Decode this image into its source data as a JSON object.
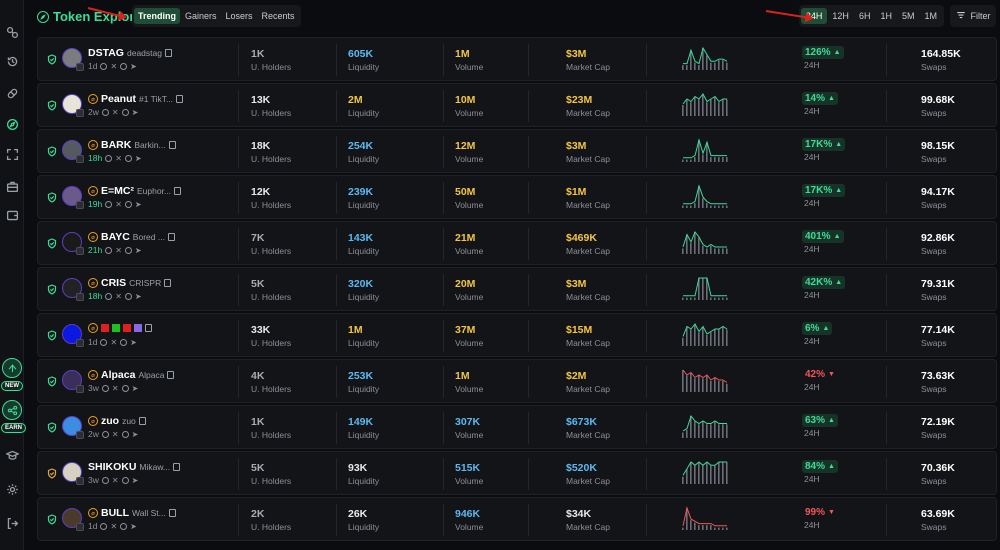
{
  "app": {
    "title": "Token Explorer",
    "accent": "#3ddc97"
  },
  "rail": {
    "badges": [
      {
        "label": "NEW"
      },
      {
        "label": "EARN"
      }
    ]
  },
  "tabs": [
    {
      "label": "Trending",
      "active": true
    },
    {
      "label": "Gainers",
      "active": false
    },
    {
      "label": "Losers",
      "active": false
    },
    {
      "label": "Recents",
      "active": false
    }
  ],
  "timeframes": [
    {
      "label": "24H",
      "active": true
    },
    {
      "label": "12H",
      "active": false
    },
    {
      "label": "6H",
      "active": false
    },
    {
      "label": "1H",
      "active": false
    },
    {
      "label": "5M",
      "active": false
    },
    {
      "label": "1M",
      "active": false
    }
  ],
  "filter_label": "Filter",
  "labels": {
    "holders": "U. Holders",
    "liquidity": "Liquidity",
    "volume": "Volume",
    "mcap": "Market Cap",
    "period": "24H",
    "swaps": "Swaps"
  },
  "tokens": [
    {
      "symbol": "DSTAG",
      "name": "deadstag",
      "age": "1d",
      "age_green": false,
      "pump": false,
      "holders": "1K",
      "liquidity": "605K",
      "volume": "1M",
      "mcap": "$3M",
      "change": "126%",
      "dir": "up",
      "swaps": "164.85K",
      "avatar": "#7a7c80",
      "liq_color": "blue",
      "vol_color": "yellow",
      "mcap_color": "yellow",
      "hold_color": "grey",
      "spark": [
        2,
        2,
        8,
        3,
        2,
        9,
        6,
        3,
        3,
        4,
        4,
        3
      ],
      "spark_color": "#3ddc97"
    },
    {
      "symbol": "Peanut",
      "name": "#1 TikT...",
      "age": "2w",
      "age_green": false,
      "pump": true,
      "holders": "13K",
      "liquidity": "2M",
      "volume": "10M",
      "mcap": "$23M",
      "change": "14%",
      "dir": "up",
      "swaps": "99.68K",
      "avatar": "#e8e4d8",
      "liq_color": "yellow",
      "vol_color": "yellow",
      "mcap_color": "yellow",
      "hold_color": "white",
      "spark": [
        4,
        6,
        5,
        7,
        6,
        8,
        5,
        6,
        7,
        5,
        6,
        6
      ],
      "spark_color": "#3ddc97"
    },
    {
      "symbol": "BARK",
      "name": "Barkin...",
      "age": "18h",
      "age_green": true,
      "pump": true,
      "holders": "18K",
      "liquidity": "254K",
      "volume": "12M",
      "mcap": "$3M",
      "change": "17K%",
      "dir": "up",
      "swaps": "98.15K",
      "avatar": "#555a60",
      "liq_color": "blue",
      "vol_color": "yellow",
      "mcap_color": "yellow",
      "hold_color": "white",
      "spark": [
        1,
        1,
        1,
        2,
        9,
        3,
        8,
        2,
        2,
        2,
        2,
        2
      ],
      "spark_color": "#3ddc97"
    },
    {
      "symbol": "E=MC²",
      "name": "Euphor...",
      "age": "19h",
      "age_green": true,
      "pump": true,
      "holders": "12K",
      "liquidity": "239K",
      "volume": "50M",
      "mcap": "$1M",
      "change": "17K%",
      "dir": "up",
      "swaps": "94.17K",
      "avatar": "#6a5a8a",
      "liq_color": "blue",
      "vol_color": "yellow",
      "mcap_color": "yellow",
      "hold_color": "white",
      "spark": [
        1,
        1,
        1,
        2,
        9,
        4,
        2,
        1,
        1,
        1,
        1,
        1
      ],
      "spark_color": "#3ddc97"
    },
    {
      "symbol": "BAYC",
      "name": "Bored ...",
      "age": "21h",
      "age_green": true,
      "pump": true,
      "holders": "7K",
      "liquidity": "143K",
      "volume": "21M",
      "mcap": "$469K",
      "change": "401%",
      "dir": "up",
      "swaps": "92.86K",
      "avatar": "#1a1a1a",
      "liq_color": "blue",
      "vol_color": "yellow",
      "mcap_color": "yellow",
      "hold_color": "grey",
      "spark": [
        2,
        7,
        4,
        8,
        6,
        3,
        2,
        3,
        2,
        2,
        2,
        2
      ],
      "spark_color": "#3ddc97"
    },
    {
      "symbol": "CRIS",
      "name": "CRISPR",
      "age": "18h",
      "age_green": true,
      "pump": true,
      "holders": "5K",
      "liquidity": "320K",
      "volume": "20M",
      "mcap": "$3M",
      "change": "42K%",
      "dir": "up",
      "swaps": "79.31K",
      "avatar": "#222226",
      "liq_color": "blue",
      "vol_color": "yellow",
      "mcap_color": "yellow",
      "hold_color": "grey",
      "spark": [
        1,
        1,
        1,
        1,
        9,
        9,
        9,
        1,
        1,
        1,
        1,
        1
      ],
      "spark_color": "#3ddc97"
    },
    {
      "symbol": "",
      "name": "",
      "age": "1d",
      "age_green": false,
      "pump": true,
      "holders": "33K",
      "liquidity": "1M",
      "volume": "37M",
      "mcap": "$15M",
      "change": "6%",
      "dir": "up",
      "swaps": "77.14K",
      "avatar": "#0a18e0",
      "liq_color": "yellow",
      "vol_color": "yellow",
      "mcap_color": "yellow",
      "hold_color": "white",
      "spark": [
        3,
        7,
        6,
        8,
        5,
        7,
        4,
        5,
        6,
        6,
        7,
        6
      ],
      "spark_color": "#3ddc97"
    },
    {
      "symbol": "Alpaca",
      "name": "Alpaca",
      "age": "3w",
      "age_green": false,
      "pump": true,
      "holders": "4K",
      "liquidity": "253K",
      "volume": "1M",
      "mcap": "$2M",
      "change": "42%",
      "dir": "down",
      "swaps": "73.63K",
      "avatar": "#3a2e5a",
      "liq_color": "blue",
      "vol_color": "yellow",
      "mcap_color": "yellow",
      "hold_color": "grey",
      "spark": [
        8,
        6,
        7,
        5,
        6,
        5,
        6,
        4,
        5,
        4,
        4,
        3
      ],
      "spark_color": "#f2555a"
    },
    {
      "symbol": "zuo",
      "name": "zuo",
      "age": "2w",
      "age_green": false,
      "pump": true,
      "holders": "1K",
      "liquidity": "149K",
      "volume": "307K",
      "mcap": "$673K",
      "change": "63%",
      "dir": "up",
      "swaps": "72.19K",
      "avatar": "#3a8de0",
      "liq_color": "blue",
      "vol_color": "blue",
      "mcap_color": "blue",
      "hold_color": "grey",
      "spark": [
        2,
        3,
        8,
        6,
        5,
        6,
        5,
        5,
        6,
        5,
        5,
        5
      ],
      "spark_color": "#3ddc97"
    },
    {
      "symbol": "SHIKOKU",
      "name": "Mikaw...",
      "age": "3w",
      "age_green": false,
      "pump": false,
      "holders": "5K",
      "liquidity": "93K",
      "volume": "515K",
      "mcap": "$520K",
      "change": "84%",
      "dir": "up",
      "swaps": "70.36K",
      "avatar": "#d8d0c0",
      "liq_color": "white",
      "vol_color": "blue",
      "mcap_color": "blue",
      "hold_color": "grey",
      "spark": [
        2,
        4,
        6,
        5,
        6,
        5,
        6,
        5,
        5,
        6,
        6,
        6
      ],
      "spark_color": "#3ddc97"
    },
    {
      "symbol": "BULL",
      "name": "Wall St...",
      "age": "1d",
      "age_green": false,
      "pump": true,
      "holders": "2K",
      "liquidity": "26K",
      "volume": "946K",
      "mcap": "$34K",
      "change": "99%",
      "dir": "down",
      "swaps": "63.69K",
      "avatar": "#4a3a2a",
      "liq_color": "white",
      "vol_color": "blue",
      "mcap_color": "white",
      "hold_color": "grey",
      "spark": [
        1,
        9,
        4,
        3,
        2,
        2,
        2,
        2,
        1,
        1,
        1,
        1
      ],
      "spark_color": "#f2555a"
    }
  ]
}
